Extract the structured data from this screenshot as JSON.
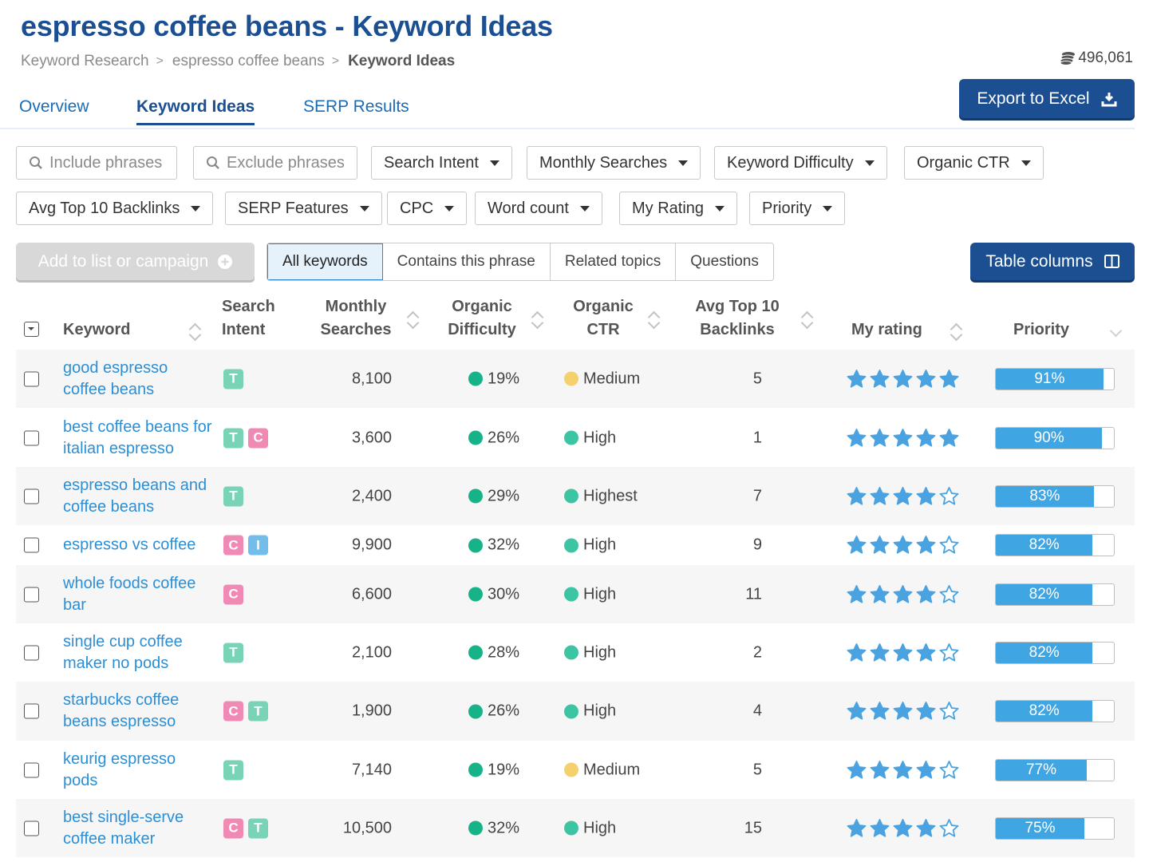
{
  "header": {
    "title": "espresso coffee beans - Keyword Ideas",
    "breadcrumb": [
      "Keyword Research",
      "espresso coffee beans",
      "Keyword Ideas"
    ],
    "credits": "496,061"
  },
  "tabs": [
    "Overview",
    "Keyword Ideas",
    "SERP Results"
  ],
  "export_label": "Export to Excel",
  "filters": {
    "include_placeholder": "Include phrases",
    "exclude_placeholder": "Exclude phrases",
    "dropdowns_row1": [
      "Search Intent",
      "Monthly Searches",
      "Keyword Difficulty",
      "Organic CTR"
    ],
    "dropdowns_row2": [
      "Avg Top 10 Backlinks",
      "SERP Features",
      "CPC",
      "Word count",
      "My Rating",
      "Priority"
    ]
  },
  "actions": {
    "add_label": "Add to list or campaign",
    "segments": [
      "All keywords",
      "Contains this phrase",
      "Related topics",
      "Questions"
    ],
    "active_segment": "All keywords",
    "table_columns_label": "Table columns"
  },
  "table": {
    "headers": {
      "keyword": "Keyword",
      "intent": [
        "Search",
        "Intent"
      ],
      "searches": [
        "Monthly",
        "Searches"
      ],
      "difficulty": [
        "Organic",
        "Difficulty"
      ],
      "ctr": [
        "Organic",
        "CTR"
      ],
      "backlinks": [
        "Avg Top 10",
        "Backlinks"
      ],
      "rating": "My rating",
      "priority": "Priority"
    },
    "colors": {
      "difficulty_green": "#17b388",
      "ctr_medium": "#f5d06e",
      "ctr_high": "#3cc4a3",
      "bar": "#3fa6e3",
      "star": "#4aa3e0"
    },
    "rows": [
      {
        "keyword": "good espresso coffee beans",
        "intent": [
          "T"
        ],
        "searches": "8,100",
        "difficulty": "19%",
        "ctr": "Medium",
        "backlinks": "5",
        "rating": 5,
        "priority": "91%",
        "priority_value": 0.91
      },
      {
        "keyword": "best coffee beans for italian espresso",
        "intent": [
          "T",
          "C"
        ],
        "searches": "3,600",
        "difficulty": "26%",
        "ctr": "High",
        "backlinks": "1",
        "rating": 5,
        "priority": "90%",
        "priority_value": 0.9
      },
      {
        "keyword": "espresso beans and coffee beans",
        "intent": [
          "T"
        ],
        "searches": "2,400",
        "difficulty": "29%",
        "ctr": "Highest",
        "backlinks": "7",
        "rating": 4,
        "priority": "83%",
        "priority_value": 0.83
      },
      {
        "keyword": "espresso vs coffee",
        "intent": [
          "C",
          "I"
        ],
        "searches": "9,900",
        "difficulty": "32%",
        "ctr": "High",
        "backlinks": "9",
        "rating": 4,
        "priority": "82%",
        "priority_value": 0.82
      },
      {
        "keyword": "whole foods coffee bar",
        "intent": [
          "C"
        ],
        "searches": "6,600",
        "difficulty": "30%",
        "ctr": "High",
        "backlinks": "11",
        "rating": 4,
        "priority": "82%",
        "priority_value": 0.82
      },
      {
        "keyword": "single cup coffee maker no pods",
        "intent": [
          "T"
        ],
        "searches": "2,100",
        "difficulty": "28%",
        "ctr": "High",
        "backlinks": "2",
        "rating": 4,
        "priority": "82%",
        "priority_value": 0.82
      },
      {
        "keyword": "starbucks coffee beans espresso",
        "intent": [
          "C",
          "T"
        ],
        "searches": "1,900",
        "difficulty": "26%",
        "ctr": "High",
        "backlinks": "4",
        "rating": 4,
        "priority": "82%",
        "priority_value": 0.82
      },
      {
        "keyword": "keurig espresso pods",
        "intent": [
          "T"
        ],
        "searches": "7,140",
        "difficulty": "19%",
        "ctr": "Medium",
        "backlinks": "5",
        "rating": 4,
        "priority": "77%",
        "priority_value": 0.77
      },
      {
        "keyword": "best single-serve coffee maker",
        "intent": [
          "C",
          "T"
        ],
        "searches": "10,500",
        "difficulty": "32%",
        "ctr": "High",
        "backlinks": "15",
        "rating": 4,
        "priority": "75%",
        "priority_value": 0.75
      }
    ]
  }
}
